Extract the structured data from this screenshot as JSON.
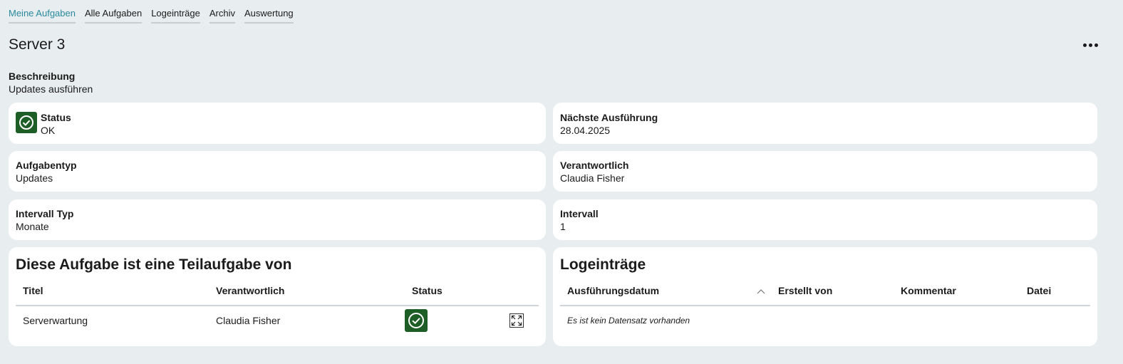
{
  "nav": {
    "tabs": [
      {
        "label": "Meine Aufgaben"
      },
      {
        "label": "Alle Aufgaben"
      },
      {
        "label": "Logeinträge"
      },
      {
        "label": "Archiv"
      },
      {
        "label": "Auswertung"
      }
    ]
  },
  "page": {
    "title": "Server 3",
    "more_icon": "more-horizontal-icon"
  },
  "description": {
    "label": "Beschreibung",
    "value": "Updates ausführen"
  },
  "fields": {
    "status": {
      "label": "Status",
      "value": "OK",
      "icon": "check-circle-icon",
      "color": "#1d5e26"
    },
    "next_run": {
      "label": "Nächste Ausführung",
      "value": "28.04.2025"
    },
    "task_type": {
      "label": "Aufgabentyp",
      "value": "Updates"
    },
    "responsible": {
      "label": "Verantwortlich",
      "value": "Claudia Fisher"
    },
    "interval_type": {
      "label": "Intervall Typ",
      "value": "Monate"
    },
    "interval": {
      "label": "Intervall",
      "value": "1"
    }
  },
  "parent_tasks": {
    "title": "Diese Aufgabe ist eine Teilaufgabe von",
    "columns": [
      "Titel",
      "Verantwortlich",
      "Status"
    ],
    "rows": [
      {
        "title": "Serverwartung",
        "responsible": "Claudia Fisher",
        "status_icon": "check-circle-icon",
        "action_icon": "expand-icon"
      }
    ]
  },
  "log_entries": {
    "title": "Logeinträge",
    "columns": [
      "Ausführungsdatum",
      "Erstellt von",
      "Kommentar",
      "Datei"
    ],
    "sort_icon": "chevron-up-icon",
    "empty_text": "Es ist kein Datensatz vorhanden"
  },
  "colors": {
    "accent": "#2a8a9c",
    "background": "#e8edf0",
    "status_ok": "#1d5e26"
  }
}
